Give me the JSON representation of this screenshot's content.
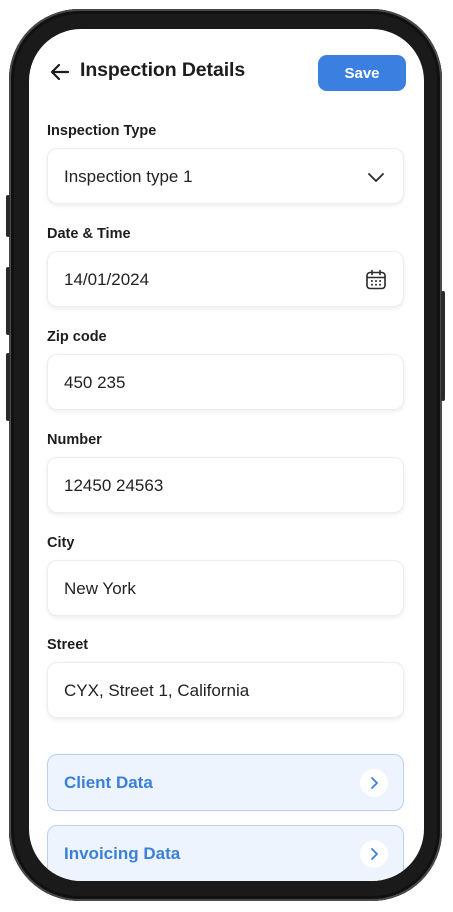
{
  "header": {
    "title": "Inspection Details",
    "save_label": "Save"
  },
  "fields": [
    {
      "label": "Inspection Type",
      "value": "Inspection type 1",
      "icon": "chevron-down-icon"
    },
    {
      "label": "Date & Time",
      "value": "14/01/2024",
      "icon": "calendar-icon"
    },
    {
      "label": "Zip code",
      "value": "450 235"
    },
    {
      "label": "Number",
      "value": "12450 24563"
    },
    {
      "label": "City",
      "value": "New York"
    },
    {
      "label": "Street",
      "value": "CYX, Street 1, California"
    }
  ],
  "sections": [
    {
      "label": "Client Data",
      "icon": "chevron-right-icon"
    },
    {
      "label": "Invoicing Data",
      "icon": "chevron-right-icon"
    }
  ],
  "colors": {
    "accent": "#3b7fe0",
    "section_text": "#3a7fd9",
    "section_bg": "#edf4fe",
    "section_border": "#b5d1f4"
  }
}
